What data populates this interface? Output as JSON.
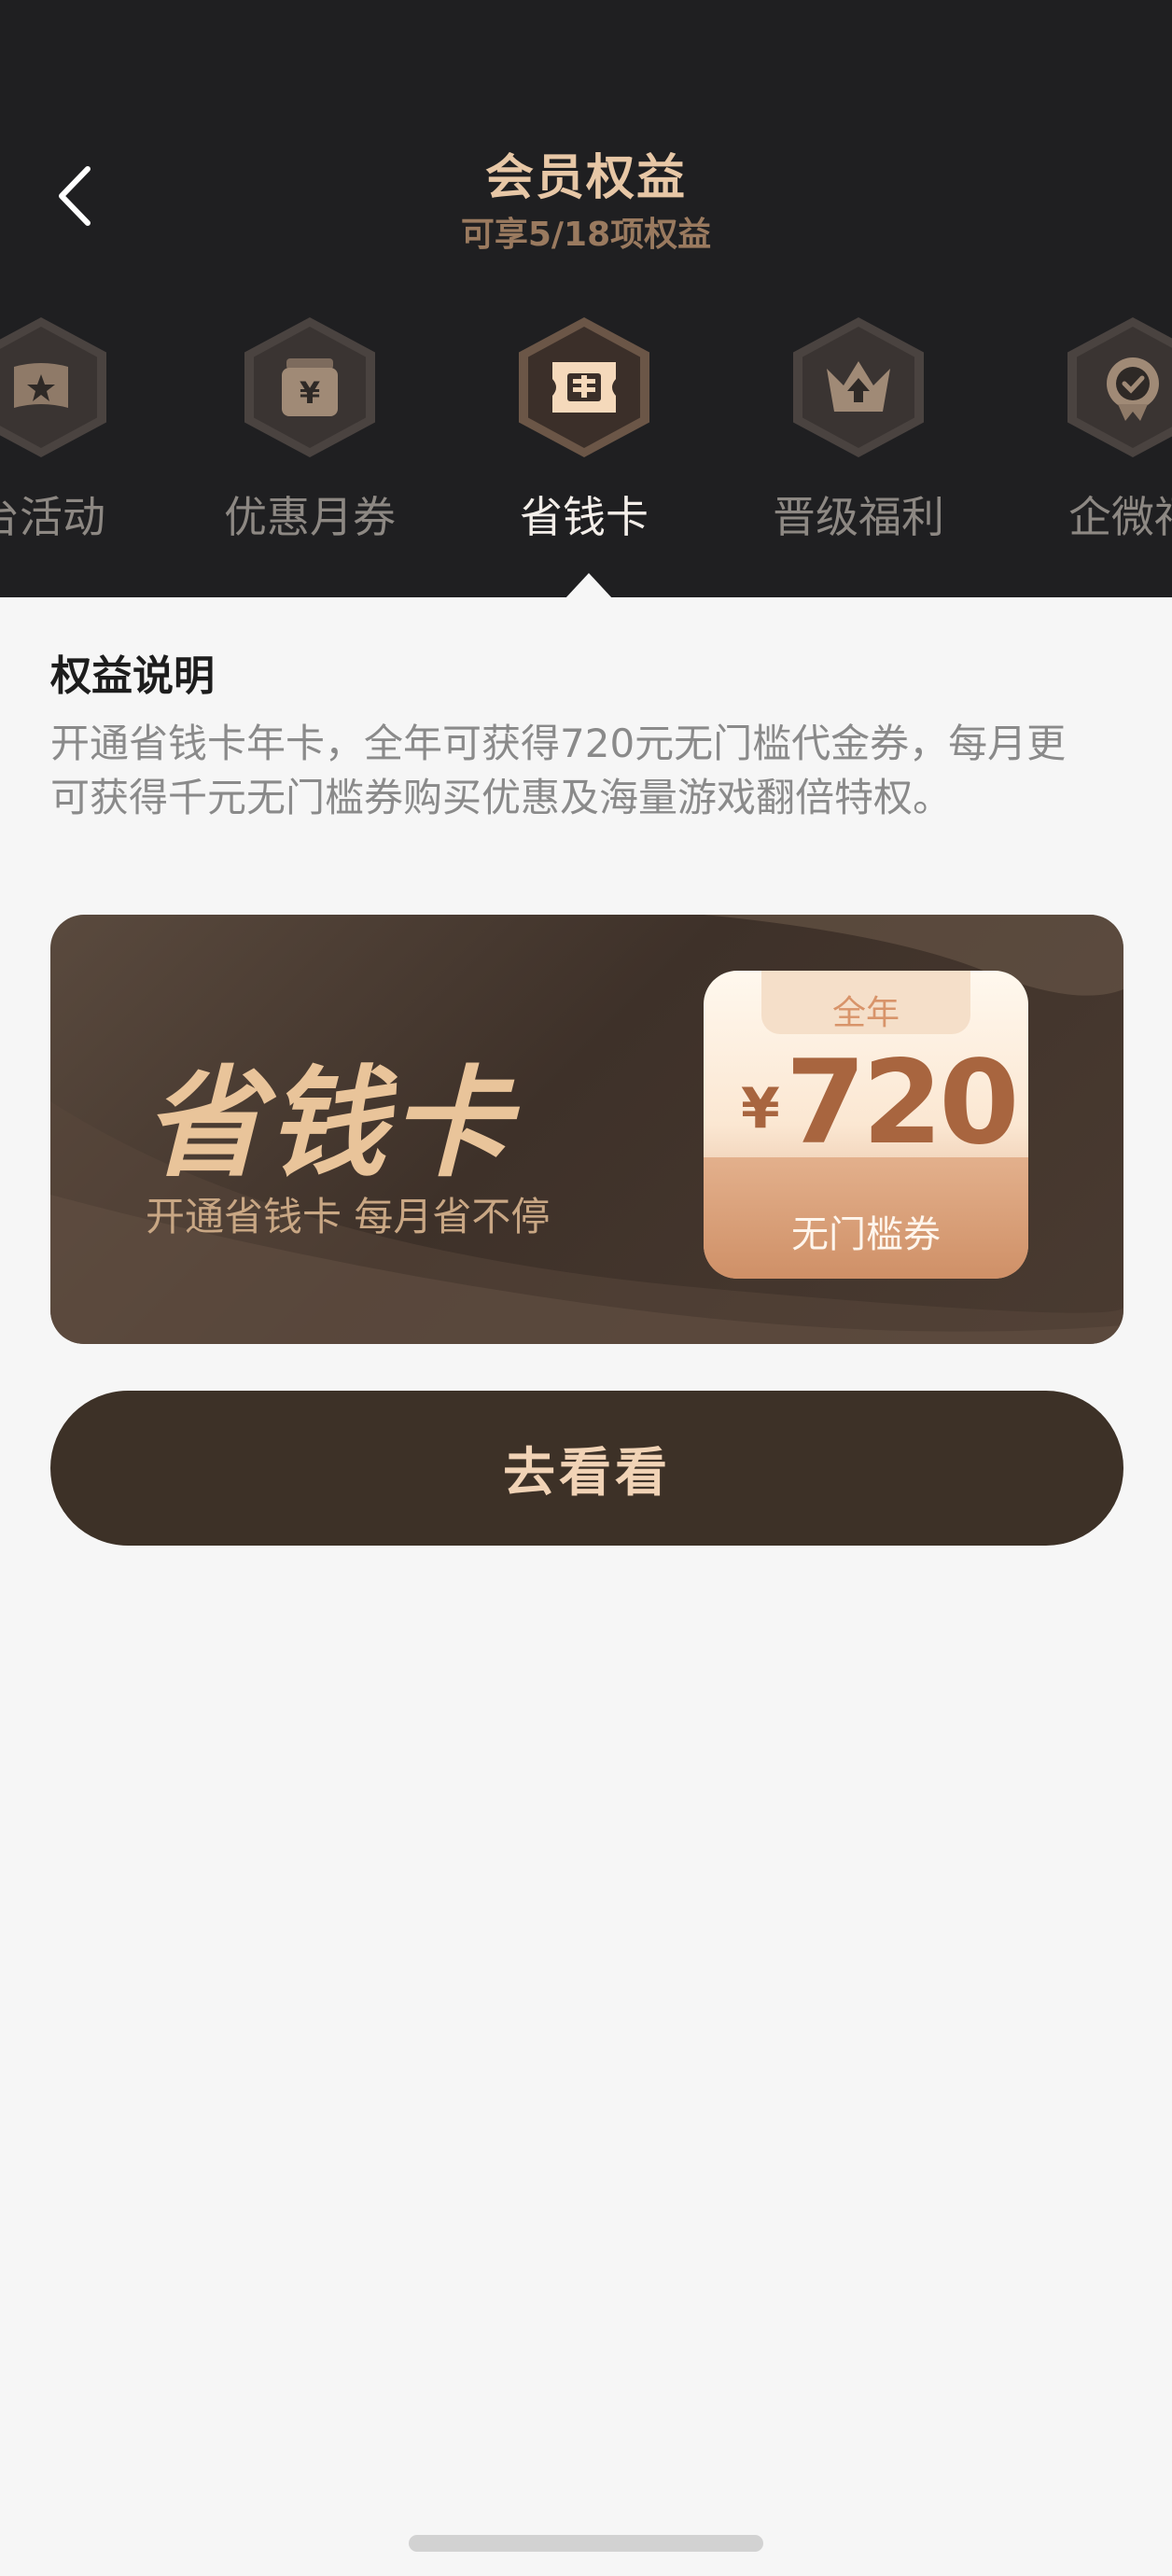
{
  "header": {
    "title": "会员权益",
    "subtitle": "可享5/18项权益"
  },
  "tabs": [
    {
      "label": "台活动",
      "icon": "star-flag-icon",
      "active": false
    },
    {
      "label": "优惠月券",
      "icon": "yen-coupon-icon",
      "active": false
    },
    {
      "label": "省钱卡",
      "icon": "save-money-card-icon",
      "active": true
    },
    {
      "label": "晋级福利",
      "icon": "crown-upgrade-icon",
      "active": false
    },
    {
      "label": "企微福",
      "icon": "badge-check-icon",
      "active": false
    }
  ],
  "benefit": {
    "section_title": "权益说明",
    "description": "开通省钱卡年卡，全年可获得720元无门槛代金券，每月更可获得千元无门槛券购买优惠及海量游戏翻倍特权。"
  },
  "promo": {
    "title": "省钱卡",
    "subtitle": "开通省钱卡 每月省不停",
    "coupon_period": "全年",
    "coupon_currency": "¥",
    "coupon_amount": "720",
    "coupon_label": "无门槛券"
  },
  "cta": {
    "label": "去看看"
  },
  "colors": {
    "header_bg": "#1f1f21",
    "accent_gold": "#e7c7a6",
    "cta_bg": "#3d3127"
  }
}
